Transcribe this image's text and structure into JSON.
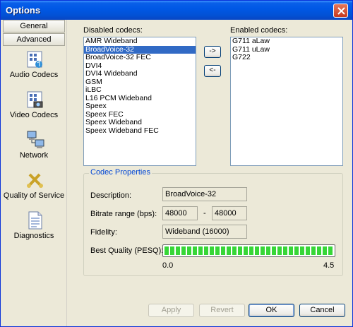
{
  "window": {
    "title": "Options"
  },
  "nav": {
    "headers": [
      "General",
      "Advanced"
    ],
    "items": [
      {
        "label": "Audio Codecs",
        "icon": "audio-codecs-icon"
      },
      {
        "label": "Video Codecs",
        "icon": "video-codecs-icon"
      },
      {
        "label": "Network",
        "icon": "network-icon"
      },
      {
        "label": "Quality of Service",
        "icon": "quality-of-service-icon"
      },
      {
        "label": "Diagnostics",
        "icon": "diagnostics-icon"
      }
    ]
  },
  "codecs": {
    "disabled_label": "Disabled codecs:",
    "enabled_label": "Enabled codecs:",
    "disabled": [
      "AMR Wideband",
      "BroadVoice-32",
      "BroadVoice-32 FEC",
      "DVI4",
      "DVI4 Wideband",
      "GSM",
      "iLBC",
      "L16 PCM Wideband",
      "Speex",
      "Speex FEC",
      "Speex Wideband",
      "Speex Wideband FEC"
    ],
    "selected": "BroadVoice-32",
    "enabled": [
      "G711 aLaw",
      "G711 uLaw",
      "G722"
    ],
    "add_button": "->",
    "remove_button": "<-"
  },
  "properties": {
    "title": "Codec Properties",
    "description_label": "Description:",
    "description_value": "BroadVoice-32",
    "bitrate_label": "Bitrate range (bps):",
    "bitrate_min": "48000",
    "bitrate_sep": "-",
    "bitrate_max": "48000",
    "fidelity_label": "Fidelity:",
    "fidelity_value": "Wideband (16000)",
    "quality_label": "Best Quality (PESQ):",
    "quality_fraction": 1.0,
    "quality_min": "0.0",
    "quality_max": "4.5"
  },
  "buttons": {
    "apply": "Apply",
    "revert": "Revert",
    "ok": "OK",
    "cancel": "Cancel"
  }
}
